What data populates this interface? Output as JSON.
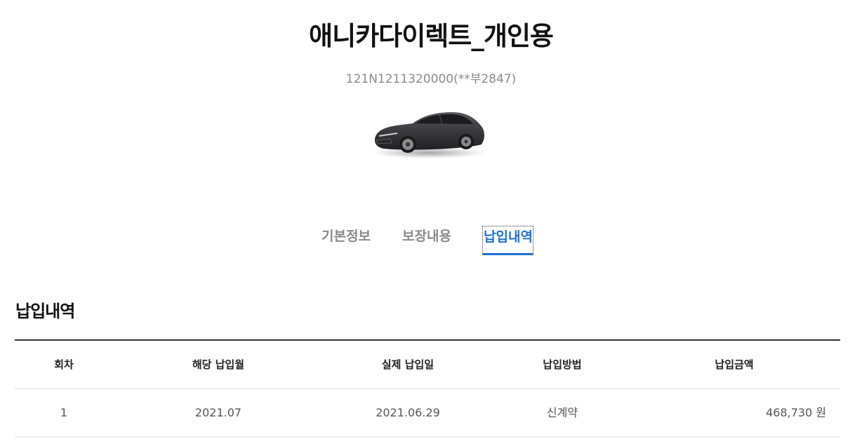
{
  "product": {
    "title": "애니카다이렉트_개인용",
    "policy_number": "121N1211320000(**부2847)"
  },
  "tabs": [
    {
      "label": "기본정보",
      "active": false
    },
    {
      "label": "보장내용",
      "active": false
    },
    {
      "label": "납입내역",
      "active": true
    }
  ],
  "colors": {
    "accent": "#1f6fd1",
    "muted_text": "#8a8a8a"
  },
  "section": {
    "title": "납입내역"
  },
  "payment_table": {
    "headers": [
      "회차",
      "해당 납입월",
      "실제 납입일",
      "납입방법",
      "납입금액"
    ],
    "rows": [
      {
        "installment": "1",
        "target_month": "2021.07",
        "paid_date": "2021.06.29",
        "method": "신계약",
        "amount": "468,730 원"
      }
    ]
  }
}
